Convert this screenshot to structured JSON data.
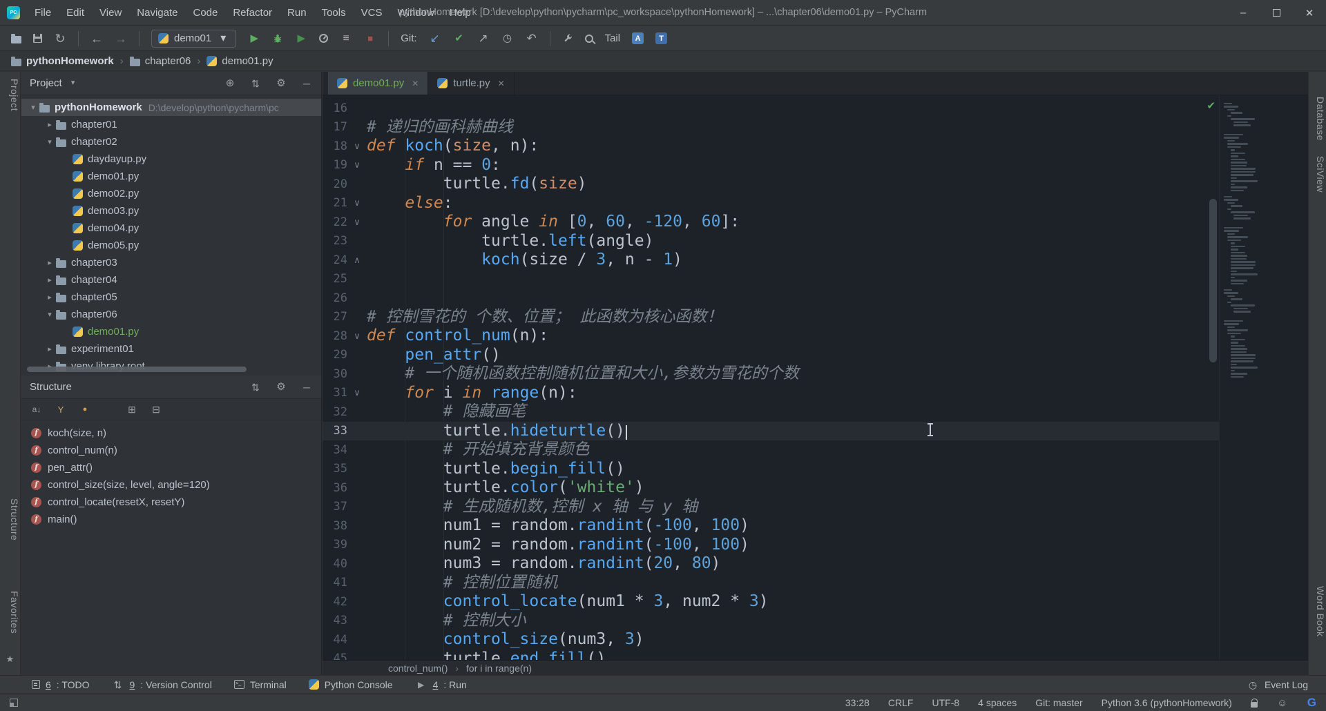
{
  "window": {
    "title": "pythonHomework [D:\\develop\\python\\pycharm\\pc_workspace\\pythonHomework] – ...\\chapter06\\demo01.py – PyCharm",
    "menus": [
      "File",
      "Edit",
      "View",
      "Navigate",
      "Code",
      "Refactor",
      "Run",
      "Tools",
      "VCS",
      "Window",
      "Help"
    ],
    "buttons": [
      "minimize",
      "maximize",
      "close"
    ]
  },
  "toolbar": {
    "left_icons": [
      "open-project-icon",
      "save-all-icon",
      "sync-icon",
      "sep",
      "back-icon",
      "forward-icon",
      "sep"
    ],
    "run_config": "demo01",
    "run_icons": [
      "run-icon",
      "debug-icon",
      "coverage-run-icon",
      "profiler-icon",
      "run-configs-icon",
      "stop-icon",
      "sep"
    ],
    "git_label": "Git:",
    "git_icons": [
      "git-update-icon",
      "git-commit-icon",
      "git-push-icon",
      "history-icon",
      "rollback-icon",
      "sep"
    ],
    "tool_icons": [
      "wrench-icon",
      "magnifier-icon"
    ],
    "tail_label": "Tail",
    "translate_icons": [
      "translate-icon",
      "translate-settings-icon"
    ]
  },
  "breadcrumbs": [
    {
      "icon": "folder-icon",
      "label": "pythonHomework"
    },
    {
      "icon": "folder-icon",
      "label": "chapter06"
    },
    {
      "icon": "python-file-icon",
      "label": "demo01.py"
    }
  ],
  "stripes": {
    "left": [
      "Project",
      "Structure",
      "Favorites"
    ],
    "right": [
      "Database",
      "SciView",
      "Word Book"
    ]
  },
  "project_panel": {
    "title": "Project",
    "header_icons": [
      "locate-icon",
      "collapse-icon",
      "gear-icon",
      "hide-icon"
    ],
    "tree": [
      {
        "level": 0,
        "arrow": "down",
        "icon": "folder-icon",
        "label": "pythonHomework",
        "path": "D:\\develop\\python\\pycharm\\pc",
        "bold": true,
        "selected": true
      },
      {
        "level": 1,
        "arrow": "right",
        "icon": "folder-icon",
        "label": "chapter01"
      },
      {
        "level": 1,
        "arrow": "down",
        "icon": "folder-icon",
        "label": "chapter02"
      },
      {
        "level": 2,
        "arrow": null,
        "icon": "python-file-icon",
        "label": "daydayup.py"
      },
      {
        "level": 2,
        "arrow": null,
        "icon": "python-file-icon",
        "label": "demo01.py"
      },
      {
        "level": 2,
        "arrow": null,
        "icon": "python-file-icon",
        "label": "demo02.py"
      },
      {
        "level": 2,
        "arrow": null,
        "icon": "python-file-icon",
        "label": "demo03.py"
      },
      {
        "level": 2,
        "arrow": null,
        "icon": "python-file-icon",
        "label": "demo04.py"
      },
      {
        "level": 2,
        "arrow": null,
        "icon": "python-file-icon",
        "label": "demo05.py"
      },
      {
        "level": 1,
        "arrow": "right",
        "icon": "folder-icon",
        "label": "chapter03"
      },
      {
        "level": 1,
        "arrow": "right",
        "icon": "folder-icon",
        "label": "chapter04"
      },
      {
        "level": 1,
        "arrow": "right",
        "icon": "folder-icon",
        "label": "chapter05"
      },
      {
        "level": 1,
        "arrow": "down",
        "icon": "folder-icon",
        "label": "chapter06"
      },
      {
        "level": 2,
        "arrow": null,
        "icon": "python-file-icon",
        "label": "demo01.py",
        "color": "#6fae59"
      },
      {
        "level": 1,
        "arrow": "right",
        "icon": "folder-icon",
        "label": "experiment01"
      },
      {
        "level": 1,
        "arrow": "right",
        "icon": "folder-icon",
        "label": "venv library root"
      }
    ]
  },
  "structure_panel": {
    "title": "Structure",
    "header_icons": [
      "collapse-icon",
      "gear-icon",
      "hide-icon"
    ],
    "toolbar_icons": [
      "sort-alpha-icon",
      "filter-icon",
      "visibility-icon",
      "gap",
      "expand-all-icon",
      "collapse-all-icon"
    ],
    "items": [
      "koch(size, n)",
      "control_num(n)",
      "pen_attr()",
      "control_size(size, level, angle=120)",
      "control_locate(resetX, resetY)",
      "main()"
    ]
  },
  "editor": {
    "tabs": [
      {
        "label": "demo01.py",
        "active": true
      },
      {
        "label": "turtle.py",
        "active": false
      }
    ],
    "current_line": 33,
    "caret": {
      "line": 33,
      "col": 28
    },
    "breadcrumb": [
      "control_num()",
      "for i in range(n)"
    ],
    "lines": [
      {
        "n": 16,
        "f": null,
        "t": []
      },
      {
        "n": 17,
        "f": null,
        "t": [
          [
            "cm",
            "# 递归的画科赫曲线"
          ]
        ]
      },
      {
        "n": 18,
        "f": "v",
        "t": [
          [
            "kw",
            "def "
          ],
          [
            "fn",
            "koch"
          ],
          [
            "tx",
            "("
          ],
          [
            "pa",
            "size"
          ],
          [
            "tx",
            ", n):"
          ]
        ]
      },
      {
        "n": 19,
        "f": "v",
        "t": [
          [
            "tx",
            "    "
          ],
          [
            "kw",
            "if "
          ],
          [
            "tx",
            "n == "
          ],
          [
            "nu",
            "0"
          ],
          [
            "tx",
            ":"
          ]
        ]
      },
      {
        "n": 20,
        "f": null,
        "t": [
          [
            "tx",
            "        turtle."
          ],
          [
            "fn",
            "fd"
          ],
          [
            "tx",
            "("
          ],
          [
            "pa",
            "size"
          ],
          [
            "tx",
            ")"
          ]
        ]
      },
      {
        "n": 21,
        "f": "v",
        "t": [
          [
            "tx",
            "    "
          ],
          [
            "kw",
            "else"
          ],
          [
            "tx",
            ":"
          ]
        ]
      },
      {
        "n": 22,
        "f": "v",
        "t": [
          [
            "tx",
            "        "
          ],
          [
            "kw",
            "for "
          ],
          [
            "tx",
            "angle "
          ],
          [
            "kw",
            "in "
          ],
          [
            "tx",
            "["
          ],
          [
            "nu",
            "0"
          ],
          [
            "tx",
            ", "
          ],
          [
            "nu",
            "60"
          ],
          [
            "tx",
            ", "
          ],
          [
            "nu",
            "-120"
          ],
          [
            "tx",
            ", "
          ],
          [
            "nu",
            "60"
          ],
          [
            "tx",
            "]:"
          ]
        ]
      },
      {
        "n": 23,
        "f": null,
        "t": [
          [
            "tx",
            "            turtle."
          ],
          [
            "fn",
            "left"
          ],
          [
            "tx",
            "(angle)"
          ]
        ]
      },
      {
        "n": 24,
        "f": "u",
        "t": [
          [
            "tx",
            "            "
          ],
          [
            "fn",
            "koch"
          ],
          [
            "tx",
            "(size / "
          ],
          [
            "nu",
            "3"
          ],
          [
            "tx",
            ", n - "
          ],
          [
            "nu",
            "1"
          ],
          [
            "tx",
            ")"
          ]
        ]
      },
      {
        "n": 25,
        "f": null,
        "t": []
      },
      {
        "n": 26,
        "f": null,
        "t": []
      },
      {
        "n": 27,
        "f": null,
        "t": [
          [
            "cm",
            "# 控制雪花的 个数、位置； 此函数为核心函数！"
          ]
        ]
      },
      {
        "n": 28,
        "f": "v",
        "t": [
          [
            "kw",
            "def "
          ],
          [
            "fn",
            "control_num"
          ],
          [
            "tx",
            "(n):"
          ]
        ]
      },
      {
        "n": 29,
        "f": null,
        "t": [
          [
            "tx",
            "    "
          ],
          [
            "fn",
            "pen_attr"
          ],
          [
            "tx",
            "()"
          ]
        ]
      },
      {
        "n": 30,
        "f": null,
        "t": [
          [
            "tx",
            "    "
          ],
          [
            "cm",
            "# 一个随机函数控制随机位置和大小,参数为雪花的个数"
          ]
        ]
      },
      {
        "n": 31,
        "f": "v",
        "t": [
          [
            "tx",
            "    "
          ],
          [
            "kw",
            "for "
          ],
          [
            "tx",
            "i "
          ],
          [
            "kw",
            "in "
          ],
          [
            "fn",
            "range"
          ],
          [
            "tx",
            "(n):"
          ]
        ]
      },
      {
        "n": 32,
        "f": null,
        "t": [
          [
            "tx",
            "        "
          ],
          [
            "cm",
            "# 隐藏画笔"
          ]
        ]
      },
      {
        "n": 33,
        "f": null,
        "current": true,
        "t": [
          [
            "tx",
            "        turtle."
          ],
          [
            "fn",
            "hideturtle"
          ],
          [
            "tx",
            "()"
          ]
        ]
      },
      {
        "n": 34,
        "f": null,
        "t": [
          [
            "tx",
            "        "
          ],
          [
            "cm",
            "# 开始填充背景颜色"
          ]
        ]
      },
      {
        "n": 35,
        "f": null,
        "t": [
          [
            "tx",
            "        turtle."
          ],
          [
            "fn",
            "begin_fill"
          ],
          [
            "tx",
            "()"
          ]
        ]
      },
      {
        "n": 36,
        "f": null,
        "t": [
          [
            "tx",
            "        turtle."
          ],
          [
            "fn",
            "color"
          ],
          [
            "tx",
            "("
          ],
          [
            "st",
            "'white'"
          ],
          [
            "tx",
            ")"
          ]
        ]
      },
      {
        "n": 37,
        "f": null,
        "t": [
          [
            "tx",
            "        "
          ],
          [
            "cm",
            "# 生成随机数,控制 x 轴 与 y 轴"
          ]
        ]
      },
      {
        "n": 38,
        "f": null,
        "t": [
          [
            "tx",
            "        num1 = random."
          ],
          [
            "fn",
            "randint"
          ],
          [
            "tx",
            "("
          ],
          [
            "nu",
            "-100"
          ],
          [
            "tx",
            ", "
          ],
          [
            "nu",
            "100"
          ],
          [
            "tx",
            ")"
          ]
        ]
      },
      {
        "n": 39,
        "f": null,
        "t": [
          [
            "tx",
            "        num2 = random."
          ],
          [
            "fn",
            "randint"
          ],
          [
            "tx",
            "("
          ],
          [
            "nu",
            "-100"
          ],
          [
            "tx",
            ", "
          ],
          [
            "nu",
            "100"
          ],
          [
            "tx",
            ")"
          ]
        ]
      },
      {
        "n": 40,
        "f": null,
        "t": [
          [
            "tx",
            "        num3 = random."
          ],
          [
            "fn",
            "randint"
          ],
          [
            "tx",
            "("
          ],
          [
            "nu",
            "20"
          ],
          [
            "tx",
            ", "
          ],
          [
            "nu",
            "80"
          ],
          [
            "tx",
            ")"
          ]
        ]
      },
      {
        "n": 41,
        "f": null,
        "t": [
          [
            "tx",
            "        "
          ],
          [
            "cm",
            "# 控制位置随机"
          ]
        ]
      },
      {
        "n": 42,
        "f": null,
        "t": [
          [
            "tx",
            "        "
          ],
          [
            "fn",
            "control_locate"
          ],
          [
            "tx",
            "(num1 * "
          ],
          [
            "nu",
            "3"
          ],
          [
            "tx",
            ", num2 * "
          ],
          [
            "nu",
            "3"
          ],
          [
            "tx",
            ")"
          ]
        ]
      },
      {
        "n": 43,
        "f": null,
        "t": [
          [
            "tx",
            "        "
          ],
          [
            "cm",
            "# 控制大小"
          ]
        ]
      },
      {
        "n": 44,
        "f": null,
        "t": [
          [
            "tx",
            "        "
          ],
          [
            "fn",
            "control_size"
          ],
          [
            "tx",
            "(num3, "
          ],
          [
            "nu",
            "3"
          ],
          [
            "tx",
            ")"
          ]
        ]
      },
      {
        "n": 45,
        "f": null,
        "t": [
          [
            "tx",
            "        turtle."
          ],
          [
            "fn",
            "end_fill"
          ],
          [
            "tx",
            "()"
          ]
        ]
      }
    ]
  },
  "bottom_bar": {
    "left": [
      {
        "icon": "todo-icon",
        "num": "6",
        "label": "TODO"
      },
      {
        "icon": "version-control-icon",
        "num": "9",
        "label": "Version Control"
      },
      {
        "icon": "terminal-icon",
        "num": "",
        "label": "Terminal"
      },
      {
        "icon": "python-console-icon",
        "num": "",
        "label": "Python Console"
      },
      {
        "icon": "run-tool-icon",
        "num": "4",
        "label": "Run"
      }
    ],
    "right": [
      {
        "icon": "event-log-icon",
        "label": "Event Log"
      }
    ]
  },
  "status_bar": {
    "items": [
      "33:28",
      "CRLF",
      "UTF-8",
      "4 spaces",
      "Git: master",
      "Python 3.6 (pythonHomework)"
    ],
    "icons": [
      "lock-icon",
      "hector-icon",
      "google-translate-icon"
    ]
  }
}
